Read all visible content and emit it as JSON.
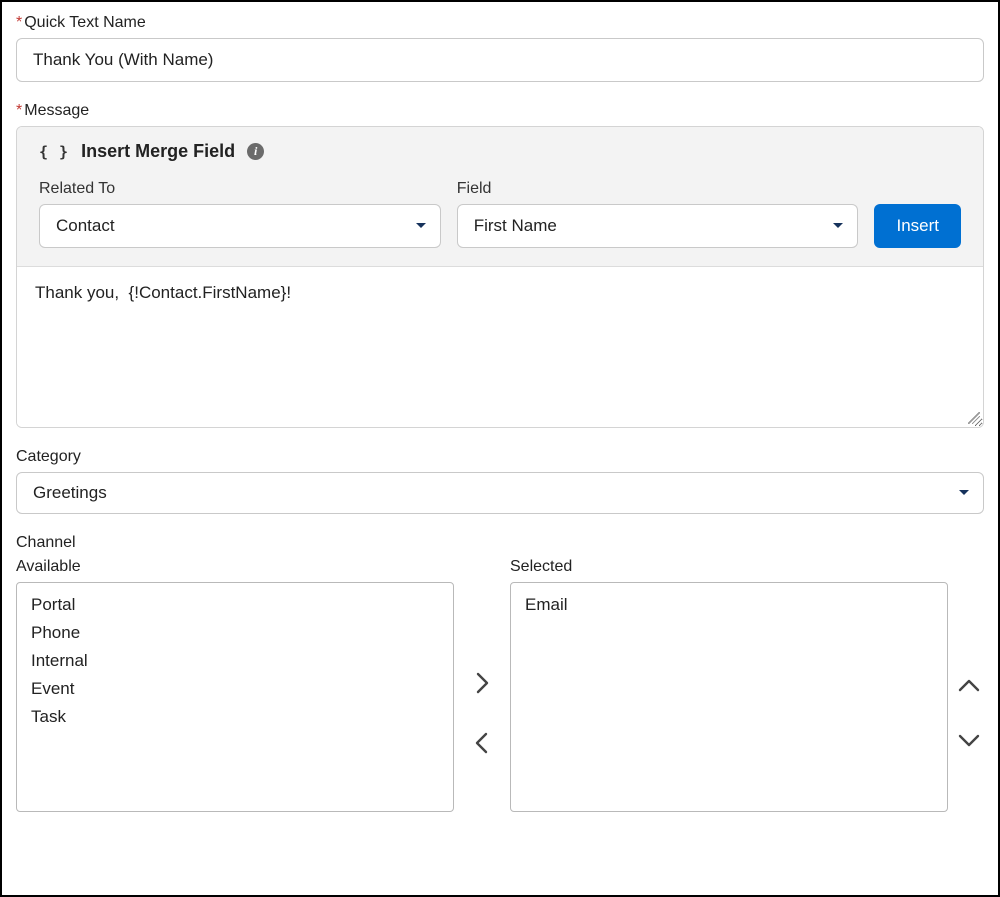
{
  "quickText": {
    "label": "Quick Text Name",
    "value": "Thank You (With Name)"
  },
  "message": {
    "label": "Message",
    "mergePanel": {
      "title": "Insert Merge Field",
      "relatedTo": {
        "label": "Related To",
        "value": "Contact"
      },
      "field": {
        "label": "Field",
        "value": "First Name"
      },
      "insertLabel": "Insert"
    },
    "body": "Thank you,  {!Contact.FirstName}!"
  },
  "category": {
    "label": "Category",
    "value": "Greetings"
  },
  "channel": {
    "label": "Channel",
    "availableLabel": "Available",
    "selectedLabel": "Selected",
    "available": [
      "Portal",
      "Phone",
      "Internal",
      "Event",
      "Task"
    ],
    "selected": [
      "Email"
    ]
  }
}
